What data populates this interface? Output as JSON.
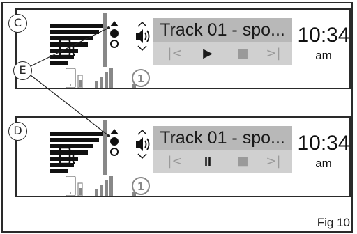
{
  "figure_label": "Fig 10",
  "callouts": {
    "c": "C",
    "d": "D",
    "e": "E"
  },
  "panel_c": {
    "track_title": "Track 01 - spo...",
    "time": "10:34",
    "ampm": "am",
    "transport": {
      "prev": "|<",
      "action": "▶",
      "stop": "■",
      "next": ">|"
    }
  },
  "panel_d": {
    "track_title": "Track 01 - spo...",
    "time": "10:34",
    "ampm": "am",
    "transport": {
      "prev": "|<",
      "action": "II",
      "stop": "■",
      "next": ">|"
    }
  }
}
